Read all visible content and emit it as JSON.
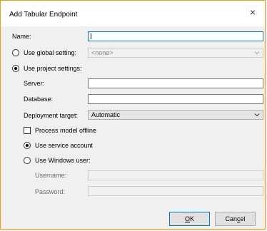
{
  "window": {
    "title": "Add Tabular Endpoint",
    "close_glyph": "×"
  },
  "form": {
    "name_label": "Name:",
    "name_value": "",
    "global_radio_label": "Use global setting:",
    "global_select_value": "<none>",
    "project_radio_label": "Use project settings:",
    "server_label": "Server:",
    "server_value": "",
    "database_label": "Database:",
    "database_value": "",
    "deploy_label": "Deployment target:",
    "deploy_value": "Automatic",
    "offline_label": "Process model offline",
    "offline_checked": false,
    "service_radio_label": "Use service account",
    "windows_radio_label": "Use Windows user:",
    "username_label": "Username:",
    "password_label": "Password:"
  },
  "buttons": {
    "ok_mnemonic": "O",
    "ok_rest": "K",
    "cancel_prefix": "Can",
    "cancel_mnemonic": "c",
    "cancel_rest": "el"
  },
  "icons": {
    "close": "close-icon",
    "dropdown": "chevron-down-icon"
  }
}
